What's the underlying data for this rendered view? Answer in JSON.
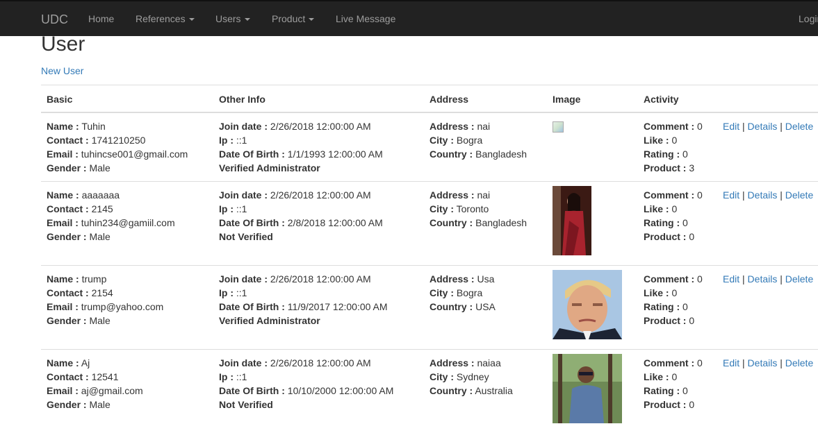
{
  "nav": {
    "brand": "UDC",
    "items": [
      {
        "label": "Home",
        "dropdown": false
      },
      {
        "label": "References",
        "dropdown": true
      },
      {
        "label": "Users",
        "dropdown": true
      },
      {
        "label": "Product",
        "dropdown": true
      },
      {
        "label": "Live Message",
        "dropdown": false
      }
    ],
    "login": "Login"
  },
  "page": {
    "title": "User",
    "new_link": "New User"
  },
  "table": {
    "headers": [
      "Basic",
      "Other Info",
      "Address",
      "Image",
      "Activity"
    ],
    "field_labels": {
      "name": "Name :",
      "contact": "Contact :",
      "email": "Email :",
      "gender": "Gender :",
      "join_date": "Join date :",
      "ip": "Ip :",
      "dob": "Date Of Birth :",
      "address": "Address :",
      "city": "City :",
      "country": "Country :",
      "comment": "Comment :",
      "like": "Like :",
      "rating": "Rating :",
      "product": "Product :"
    },
    "action_labels": {
      "edit": "Edit",
      "details": "Details",
      "delete": "Delete",
      "sep": "|"
    },
    "rows": [
      {
        "name": "Tuhin",
        "contact": "1741210250",
        "email": "tuhincse001@gmail.com",
        "gender": "Male",
        "join_date": "2/26/2018 12:00:00 AM",
        "ip": "::1",
        "dob": "1/1/1993 12:00:00 AM",
        "status": "Verified Administrator",
        "address": "nai",
        "city": "Bogra",
        "country": "Bangladesh",
        "image": "broken-image-icon",
        "comment": "0",
        "like": "0",
        "rating": "0",
        "product": "3"
      },
      {
        "name": "aaaaaaa",
        "contact": "2145",
        "email": "tuhin234@gamiil.com",
        "gender": "Male",
        "join_date": "2/26/2018 12:00:00 AM",
        "ip": "::1",
        "dob": "2/8/2018 12:00:00 AM",
        "status": "Not Verified",
        "address": "nai",
        "city": "Toronto",
        "country": "Bangladesh",
        "image": "woman-red-saree-photo",
        "comment": "0",
        "like": "0",
        "rating": "0",
        "product": "0"
      },
      {
        "name": "trump",
        "contact": "2154",
        "email": "trump@yahoo.com",
        "gender": "Male",
        "join_date": "2/26/2018 12:00:00 AM",
        "ip": "::1",
        "dob": "11/9/2017 12:00:00 AM",
        "status": "Verified Administrator",
        "address": "Usa",
        "city": "Bogra",
        "country": "USA",
        "image": "man-portrait-photo",
        "comment": "0",
        "like": "0",
        "rating": "0",
        "product": "0"
      },
      {
        "name": "Aj",
        "contact": "12541",
        "email": "aj@gmail.com",
        "gender": "Male",
        "join_date": "2/26/2018 12:00:00 AM",
        "ip": "::1",
        "dob": "10/10/2000 12:00:00 AM",
        "status": "Not Verified",
        "address": "naiaa",
        "city": "Sydney",
        "country": "Australia",
        "image": "man-outdoor-photo",
        "comment": "0",
        "like": "0",
        "rating": "0",
        "product": "0"
      }
    ]
  }
}
